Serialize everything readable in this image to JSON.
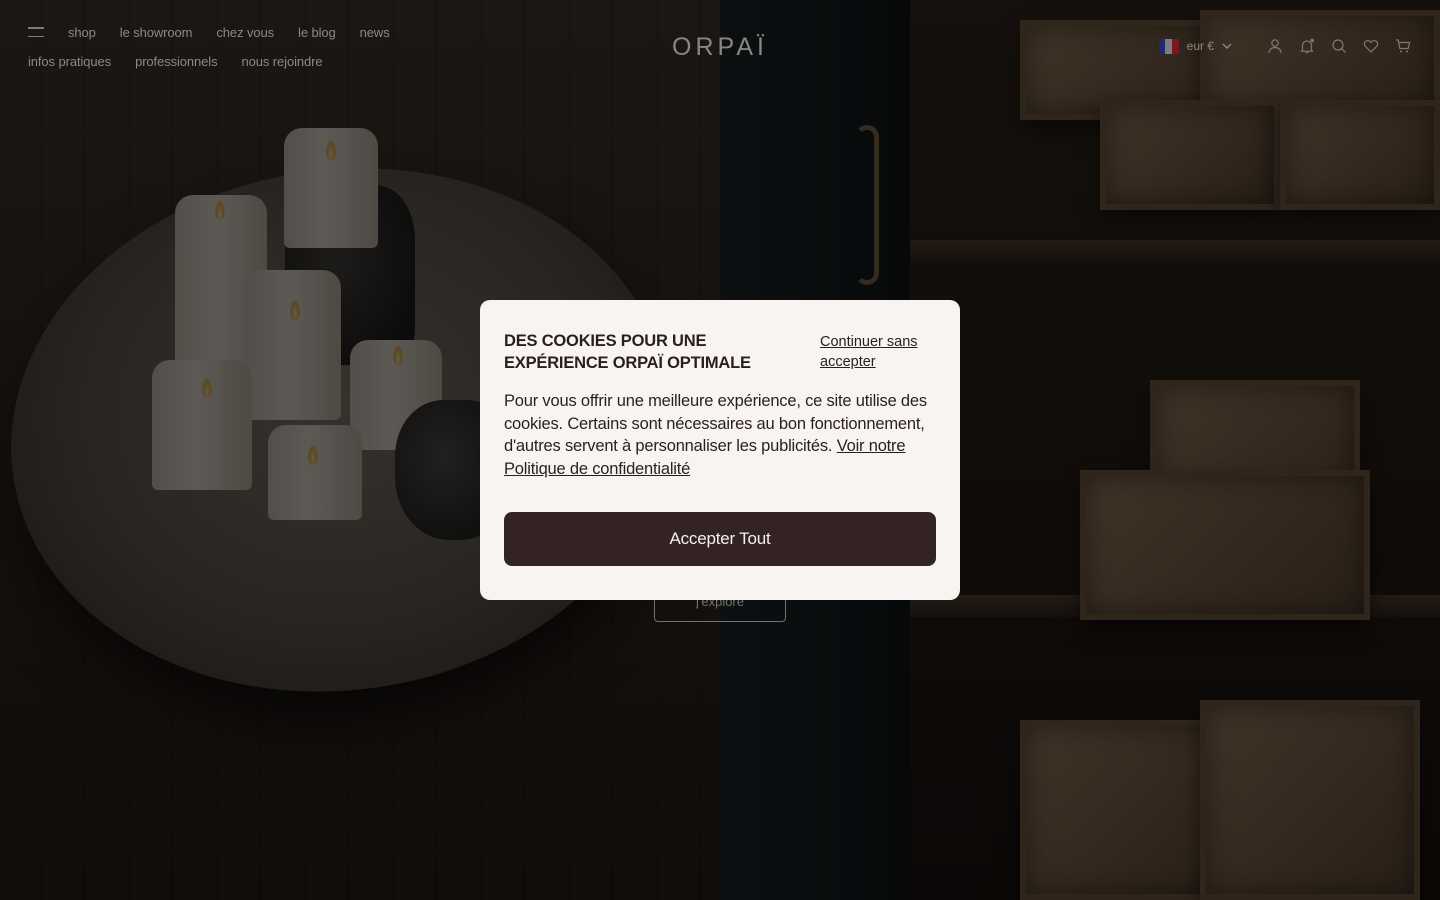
{
  "header": {
    "menu_icon": "hamburger-menu-icon",
    "nav_primary": [
      "shop",
      "le showroom",
      "chez vous",
      "le blog",
      "news"
    ],
    "nav_secondary": [
      "infos pratiques",
      "professionnels",
      "nous rejoindre"
    ],
    "logo": "ORPAÏ",
    "currency": {
      "label": "eur €",
      "flag": "france-flag-icon"
    },
    "icons": [
      "account-icon",
      "notifications-icon",
      "search-icon",
      "wishlist-heart-icon",
      "cart-icon"
    ]
  },
  "hero": {
    "cta_label": "j'explore"
  },
  "cookie_modal": {
    "title": "DES COOKIES POUR UNE EXPÉRIENCE ORPAÏ OPTIMALE",
    "skip_label": "Continuer sans accepter",
    "body": "Pour vous offrir une meilleure expérience, ce site utilise des cookies. Certains sont nécessaires au bon fonctionnement, d'autres servent à personnaliser les publicités.",
    "policy_link": "Voir notre Politique de confidentialité",
    "accept_label": "Accepter Tout"
  },
  "colors": {
    "modal_bg": "#f8f4f1",
    "button_bg": "#332322",
    "text_dark": "#2b1f1d"
  }
}
